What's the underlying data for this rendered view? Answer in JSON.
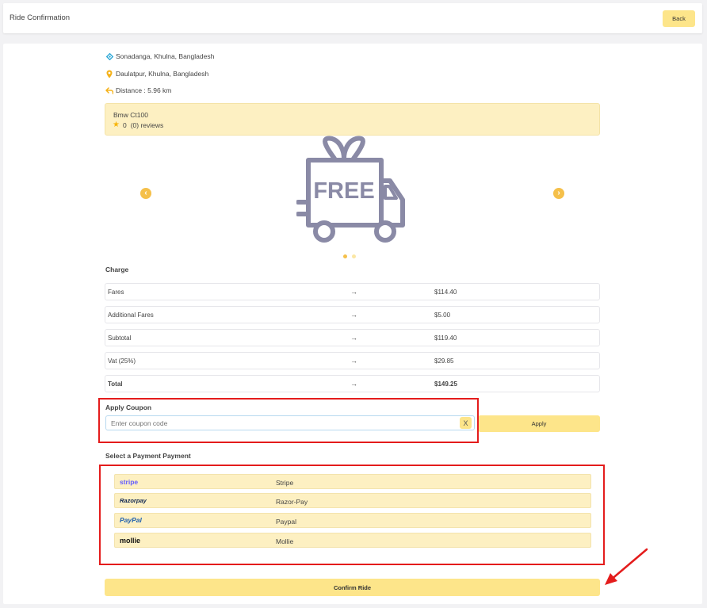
{
  "header": {
    "title": "Ride Confirmation",
    "back_label": "Back"
  },
  "trip": {
    "pickup": "Sonadanga, Khulna, Bangladesh",
    "dropoff": "Daulatpur, Khulna, Bangladesh",
    "distance": "Distance : 5.96 km"
  },
  "vehicle": {
    "name": "Bmw Ct100",
    "rating": "0",
    "reviews": "(0) reviews"
  },
  "carousel": {
    "image_text": "FREE",
    "active_index": 0,
    "count": 2
  },
  "charge": {
    "title": "Charge",
    "arrow": "→",
    "rows": [
      {
        "label": "Fares",
        "value": "$114.40"
      },
      {
        "label": "Additional Fares",
        "value": "$5.00"
      },
      {
        "label": "Subtotal",
        "value": "$119.40"
      },
      {
        "label": "Vat (25%)",
        "value": "$29.85"
      },
      {
        "label": "Total",
        "value": "$149.25"
      }
    ]
  },
  "coupon": {
    "title": "Apply Coupon",
    "placeholder": "Enter coupon code",
    "clear_label": "X",
    "apply_label": "Apply"
  },
  "payment": {
    "title": "Select a Payment Payment",
    "methods": [
      {
        "logo": "stripe",
        "name": "Stripe"
      },
      {
        "logo": "Razorpay",
        "name": "Razor-Pay"
      },
      {
        "logo": "PayPal",
        "name": "Paypal"
      },
      {
        "logo": "mollie",
        "name": "Mollie"
      }
    ]
  },
  "confirm_label": "Confirm Ride",
  "colors": {
    "accent": "#fde58a",
    "highlight": "#e41c1c",
    "star": "#f7b50a"
  }
}
